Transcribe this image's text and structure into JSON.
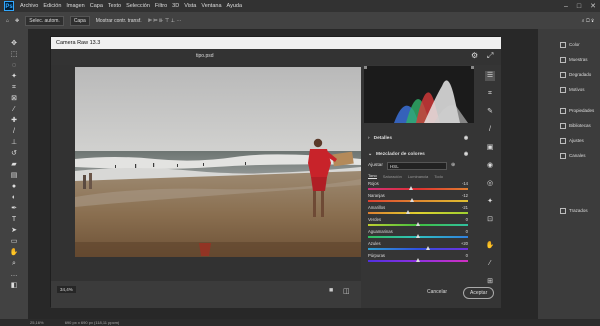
{
  "menubar": {
    "items": [
      "Archivo",
      "Edición",
      "Imagen",
      "Capa",
      "Texto",
      "Selección",
      "Filtro",
      "3D",
      "Vista",
      "Ventana",
      "Ayuda"
    ]
  },
  "optbar": {
    "items": [
      "Selec. autom.",
      "Capa",
      "Mostrar contr. transf."
    ]
  },
  "right_panel": {
    "items": [
      "Color",
      "Muestras",
      "Degradado",
      "Motivos",
      "Propiedades",
      "Bibliotecas",
      "Ajustes",
      "Canales",
      "Trazados"
    ]
  },
  "statusbar": {
    "zoom": "25,16%",
    "size": "690 px x 690 px (118,11 ppcm)"
  },
  "camera_raw": {
    "title": "Camera Raw 13.3",
    "file": "tipo.psd",
    "zoom": "34,4%",
    "sections": {
      "details": "Detalles",
      "color_mixer": "Mezclador de colores"
    },
    "adjust_label": "Ajustar",
    "adjust_value": "HSL",
    "tabs": [
      "Tono",
      "Saturación",
      "Luminancia",
      "Todo"
    ],
    "sliders": [
      {
        "label": "Rojos",
        "value": "-14",
        "pos": 0.43
      },
      {
        "label": "Naranjas",
        "value": "-12",
        "pos": 0.44
      },
      {
        "label": "Amarillos",
        "value": "-21",
        "pos": 0.4
      },
      {
        "label": "Verdes",
        "value": "0",
        "pos": 0.5
      },
      {
        "label": "Aguamarinas",
        "value": "0",
        "pos": 0.5
      },
      {
        "label": "Azules",
        "value": "+20",
        "pos": 0.6
      },
      {
        "label": "Púrpuras",
        "value": "0",
        "pos": 0.5
      }
    ],
    "cancel": "Cancelar",
    "accept": "Aceptar"
  },
  "colors": {
    "accent": "#31a8ff"
  }
}
